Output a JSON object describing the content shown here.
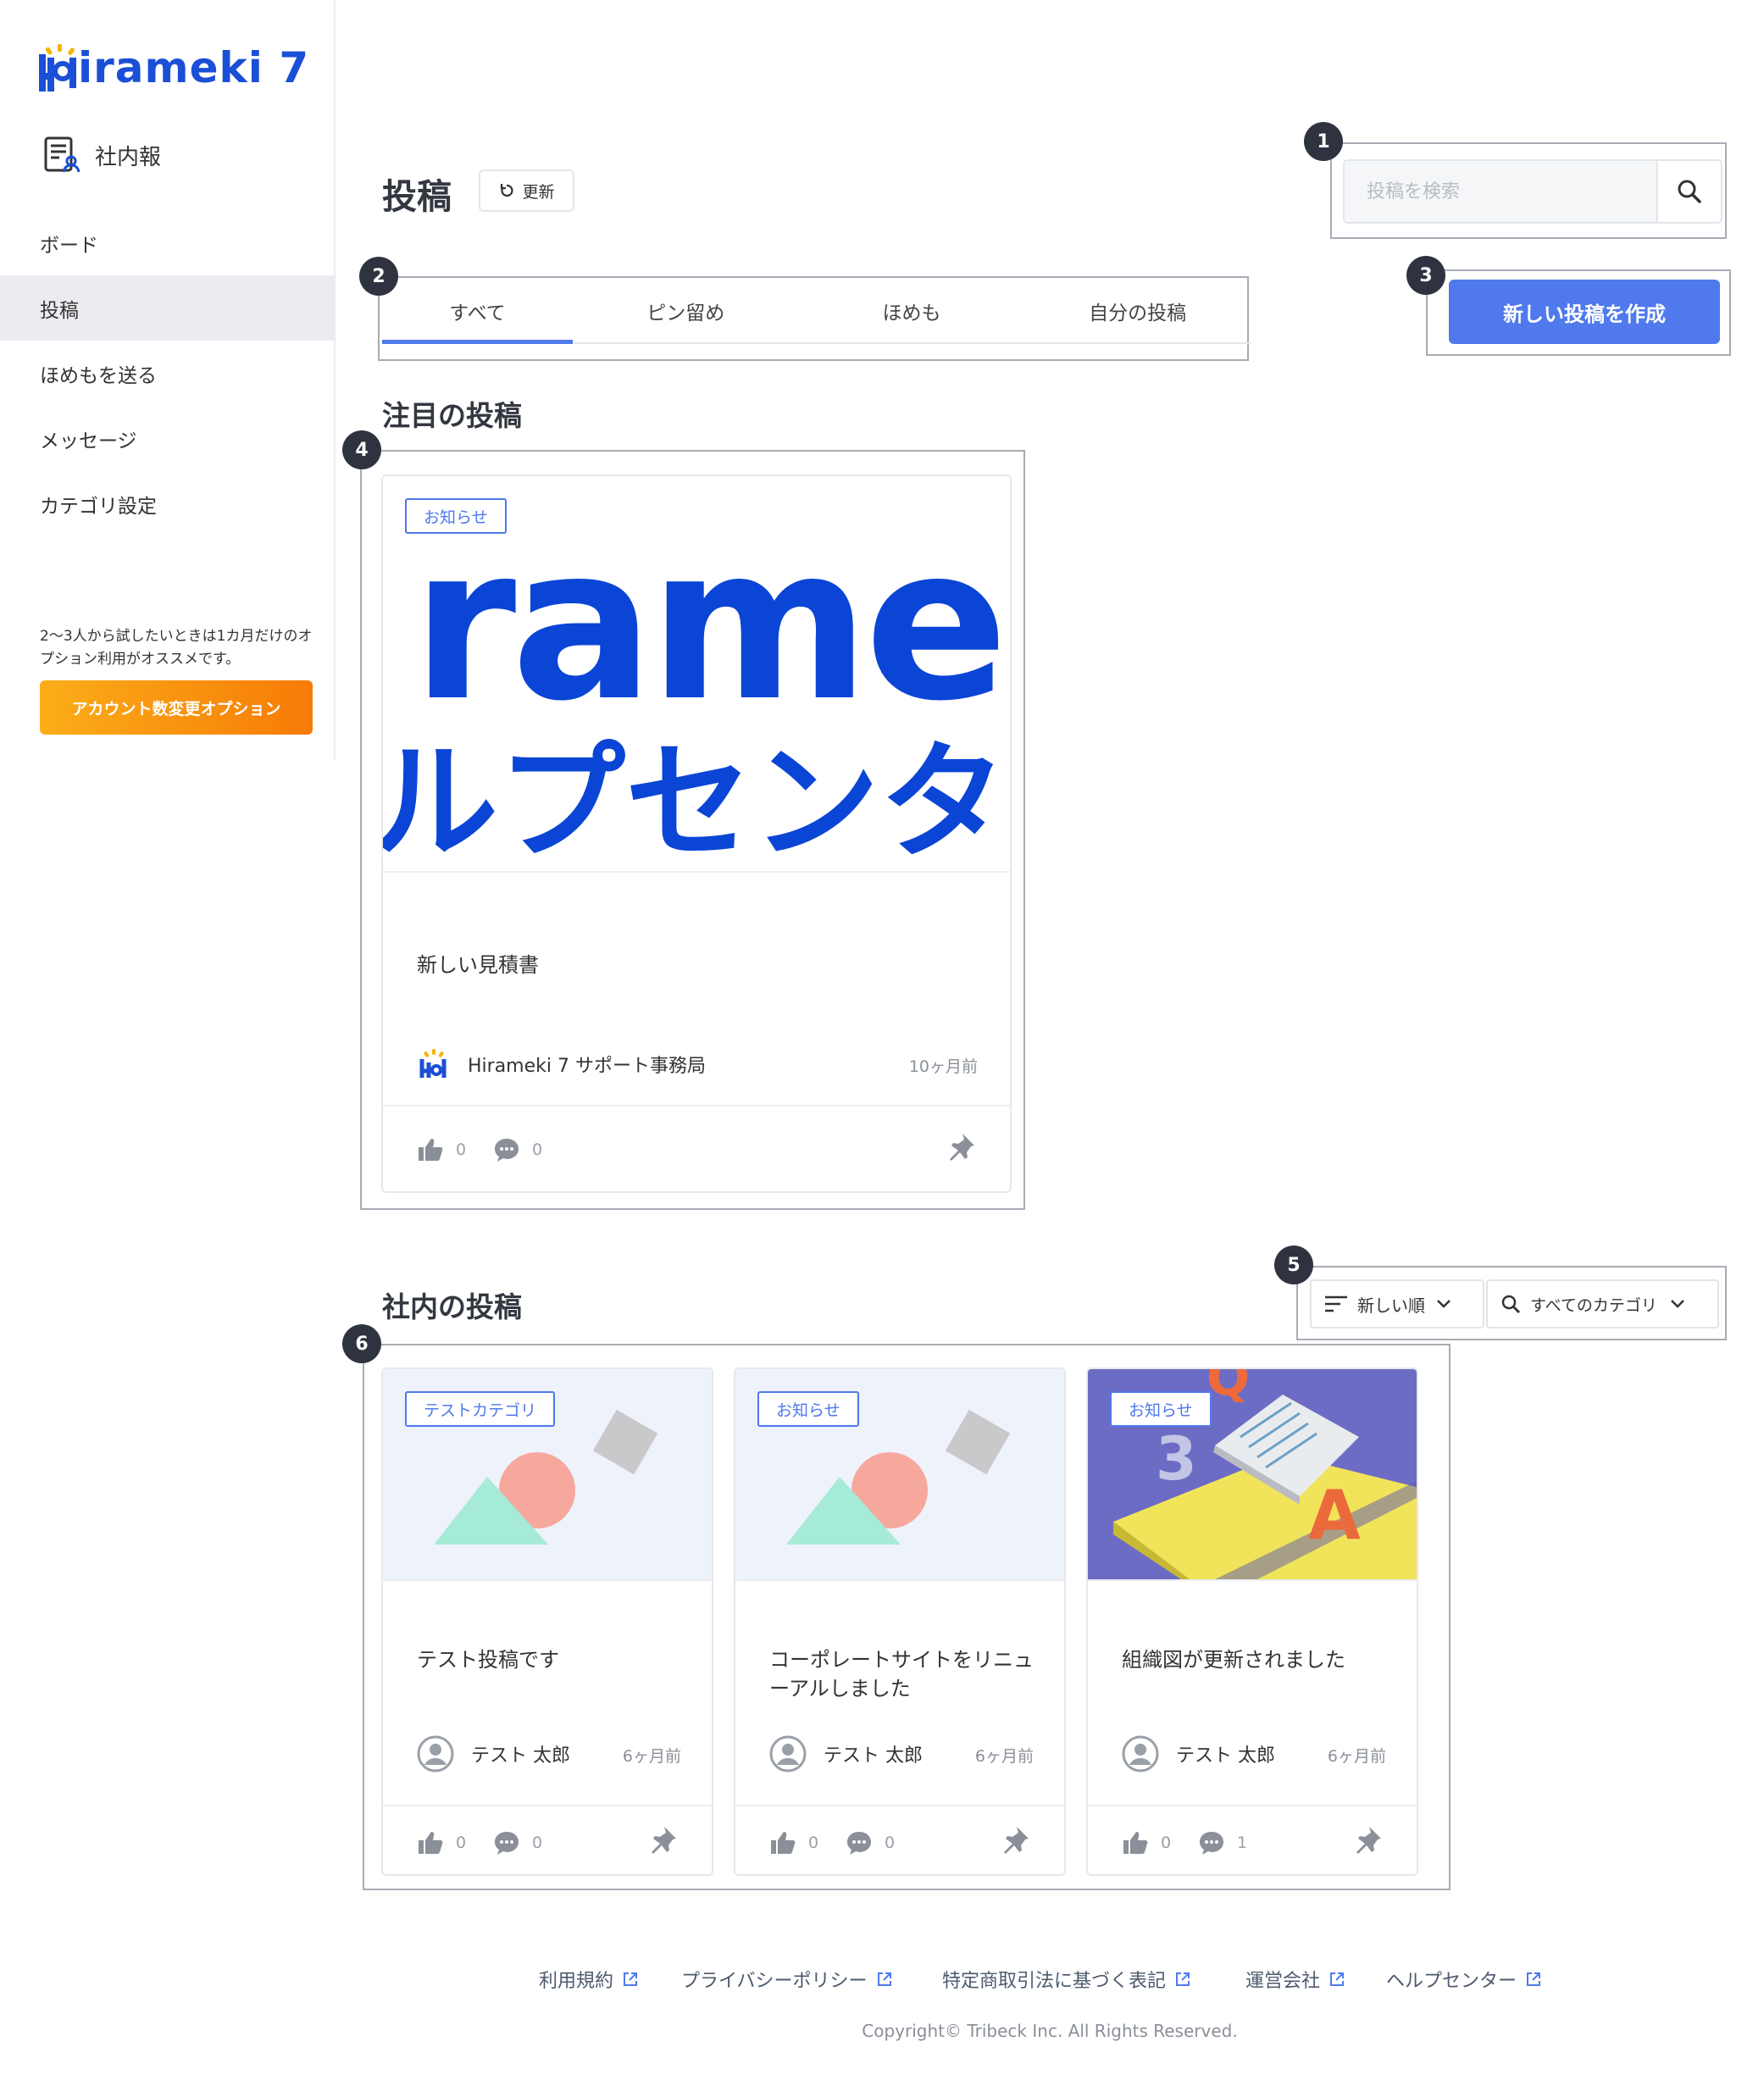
{
  "app": {
    "logo_text": "irameki 7",
    "section": "社内報"
  },
  "sidebar": {
    "items": [
      {
        "label": "ボード"
      },
      {
        "label": "投稿"
      },
      {
        "label": "ほめもを送る"
      },
      {
        "label": "メッセージ"
      },
      {
        "label": "カテゴリ設定"
      }
    ],
    "promo_text": "2〜3人から試したいときは1カ月だけのオプション利用がオススメです。",
    "promo_button": "アカウント数変更オプション"
  },
  "header": {
    "title": "投稿",
    "refresh_label": "更新"
  },
  "search": {
    "placeholder": "投稿を検索"
  },
  "create_button": "新しい投稿を作成",
  "tabs": [
    "すべて",
    "ピン留め",
    "ほめも",
    "自分の投稿"
  ],
  "callouts": [
    "1",
    "2",
    "3",
    "4",
    "5",
    "6"
  ],
  "featured": {
    "section_title": "注目の投稿",
    "card": {
      "tag": "お知らせ",
      "banner_line1": "ramek",
      "banner_line2": "ルプセンタ",
      "title": "新しい見積書",
      "author": "Hirameki 7 サポート事務局",
      "time": "10ヶ月前",
      "likes": "0",
      "comments": "0"
    }
  },
  "internal": {
    "section_title": "社内の投稿",
    "sort_label": "新しい順",
    "category_label": "すべてのカテゴリ",
    "cards": [
      {
        "tag": "テストカテゴリ",
        "title": "テスト投稿です",
        "author": "テスト 太郎",
        "time": "6ヶ月前",
        "likes": "0",
        "comments": "0"
      },
      {
        "tag": "お知らせ",
        "title": "コーポレートサイトをリニューアルしました",
        "author": "テスト 太郎",
        "time": "6ヶ月前",
        "likes": "0",
        "comments": "0"
      },
      {
        "tag": "お知らせ",
        "title": "組織図が更新されました",
        "author": "テスト 太郎",
        "time": "6ヶ月前",
        "likes": "0",
        "comments": "1"
      }
    ]
  },
  "footer": {
    "links": [
      "利用規約",
      "プライバシーポリシー",
      "特定商取引法に基づく表記",
      "運営会社",
      "ヘルプセンター"
    ],
    "copyright": "Copyright© Tribeck Inc. All Rights Reserved."
  },
  "colors": {
    "brand": "#1a4fd6",
    "accent": "#4f79ed",
    "promo": "#f88a0c"
  }
}
